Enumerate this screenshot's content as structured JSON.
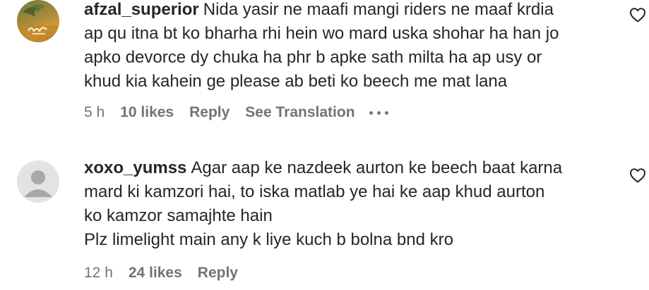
{
  "comments": [
    {
      "username": "afzal_superior",
      "lines": [
        "Nida yasir ne maafi mangi riders ne maaf krdia",
        "ap qu itna bt ko bharha rhi hein wo mard uska shohar ha han jo",
        "apko devorce dy chuka ha phr b apke sath milta ha ap usy or",
        "khud kia kahein ge please ab beti ko beech me mat lana"
      ],
      "time": "5 h",
      "likes": "10 likes",
      "reply": "Reply",
      "translation": "See Translation",
      "avatar_icon": "profile-photo-icon",
      "like_icon": "heart-outline-icon"
    },
    {
      "username": "xoxo_yumss",
      "lines": [
        "Agar aap ke nazdeek aurton ke beech baat karna",
        "mard ki kamzori hai, to iska matlab ye hai ke aap khud aurton",
        "ko kamzor samajhte hain",
        "Plz limelight main any k liye kuch b bolna bnd kro"
      ],
      "time": "12 h",
      "likes": "24 likes",
      "reply": "Reply",
      "avatar_icon": "default-avatar-icon",
      "like_icon": "heart-outline-icon"
    }
  ],
  "colors": {
    "text": "#262626",
    "secondary": "#737373",
    "background": "#ffffff"
  }
}
